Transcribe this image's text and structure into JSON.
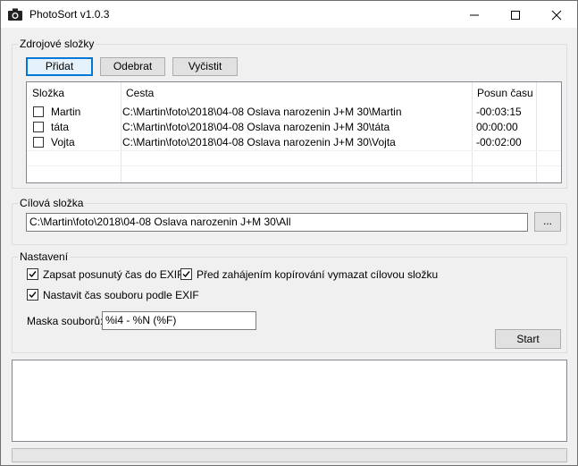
{
  "window": {
    "title": "PhotoSort v1.0.3"
  },
  "source": {
    "legend": "Zdrojové složky",
    "add_label": "Přidat",
    "remove_label": "Odebrat",
    "clear_label": "Vyčistit",
    "columns": [
      "Složka",
      "Cesta",
      "Posun času"
    ],
    "rows": [
      {
        "checked": false,
        "folder": "Martin",
        "path": "C:\\Martin\\foto\\2018\\04-08 Oslava narozenin J+M 30\\Martin",
        "offset": "-00:03:15"
      },
      {
        "checked": false,
        "folder": "táta",
        "path": "C:\\Martin\\foto\\2018\\04-08 Oslava narozenin J+M 30\\táta",
        "offset": "00:00:00"
      },
      {
        "checked": false,
        "folder": "Vojta",
        "path": "C:\\Martin\\foto\\2018\\04-08 Oslava narozenin J+M 30\\Vojta",
        "offset": "-00:02:00"
      }
    ]
  },
  "target": {
    "legend": "Cílová složka",
    "path": "C:\\Martin\\foto\\2018\\04-08 Oslava narozenin J+M 30\\All",
    "browse_label": "..."
  },
  "settings": {
    "legend": "Nastavení",
    "opt_write_exif": {
      "label": "Zapsat posunutý čas do EXIF",
      "checked": true
    },
    "opt_clear_target": {
      "label": "Před zahájením kopírování vymazat cílovou složku",
      "checked": true
    },
    "opt_file_time": {
      "label": "Nastavit čas souboru podle EXIF",
      "checked": true
    },
    "mask_label": "Maska souborů:",
    "mask_value": "%i4 - %N (%F)",
    "start_label": "Start"
  },
  "log": {
    "text": ""
  },
  "progress": {
    "fraction": 0
  },
  "colors": {
    "accent": "#0078d7",
    "progress": "#06b025"
  }
}
